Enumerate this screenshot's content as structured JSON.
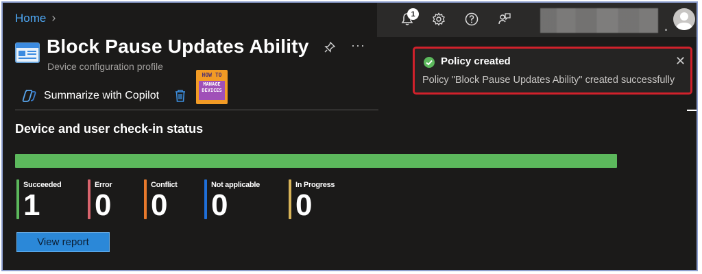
{
  "breadcrumb": {
    "home": "Home"
  },
  "header": {
    "title": "Block Pause Updates Ability",
    "subtitle": "Device configuration profile",
    "pin_icon": "pin-icon",
    "more_label": "···"
  },
  "topbar": {
    "notification_count": "1",
    "icons": [
      "bell-icon",
      "gear-icon",
      "help-icon",
      "feedback-icon",
      "avatar"
    ]
  },
  "commandbar": {
    "copilot_label": "Summarize with Copilot",
    "delete_icon": "trash-icon"
  },
  "watermark_logo": {
    "top": "HOW TO",
    "line1": "MANAGE",
    "line2": "DEVICES"
  },
  "checkin": {
    "section_title": "Device and user check-in status",
    "bar_color": "#5cb85c",
    "stats": [
      {
        "label": "Succeeded",
        "value": "1",
        "color": "#5cb85c"
      },
      {
        "label": "Error",
        "value": "0",
        "color": "#d9646d"
      },
      {
        "label": "Conflict",
        "value": "0",
        "color": "#e8792b"
      },
      {
        "label": "Not applicable",
        "value": "0",
        "color": "#1f6fd8"
      },
      {
        "label": "In Progress",
        "value": "0",
        "color": "#d8b458"
      }
    ],
    "view_report_label": "View report"
  },
  "toast": {
    "title": "Policy created",
    "message": "Policy \"Block Pause Updates Ability\" created successfully",
    "close_label": "✕"
  }
}
